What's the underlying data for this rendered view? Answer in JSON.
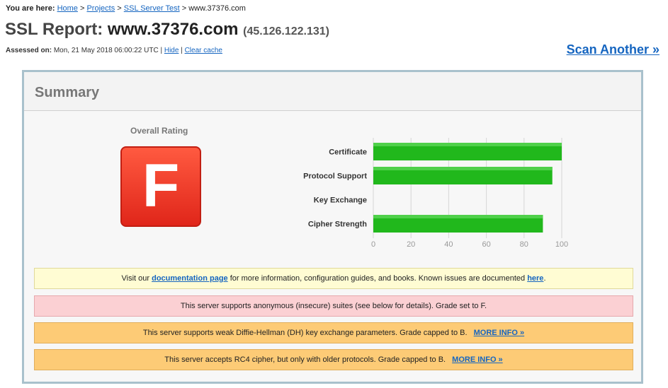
{
  "breadcrumb": {
    "prefix": "You are here:",
    "items": [
      "Home",
      "Projects",
      "SSL Server Test"
    ],
    "current": "www.37376.com",
    "sep": ">"
  },
  "report": {
    "title_prefix": "SSL Report:",
    "host": "www.37376.com",
    "ip": "(45.126.122.131)",
    "assessed_label": "Assessed on:",
    "assessed_value": "Mon, 21 May 2018 06:00:22 UTC",
    "hide_link": "Hide",
    "clear_cache_link": "Clear cache",
    "scan_another": "Scan Another »"
  },
  "summary": {
    "title": "Summary",
    "overall_label": "Overall Rating",
    "grade": "F",
    "grade_color": "#e8321f"
  },
  "chart_data": {
    "type": "bar",
    "orientation": "horizontal",
    "categories": [
      "Certificate",
      "Protocol Support",
      "Key Exchange",
      "Cipher Strength"
    ],
    "values": [
      100,
      95,
      0,
      90
    ],
    "xlim": [
      0,
      100
    ],
    "xticks": [
      0,
      20,
      40,
      60,
      80,
      100
    ],
    "grid": true,
    "bar_color": "#21b81c"
  },
  "messages": {
    "doc": {
      "pre": "Visit our",
      "link1": "documentation page",
      "mid": "for more information, configuration guides, and books. Known issues are documented",
      "link2": "here",
      "post": "."
    },
    "anon": "This server supports anonymous (insecure) suites (see below for details). Grade set to F.",
    "dh": "This server supports weak Diffie-Hellman (DH) key exchange parameters. Grade capped to B.",
    "rc4": "This server accepts RC4 cipher, but only with older protocols. Grade capped to B.",
    "more_info": "MORE INFO »"
  }
}
